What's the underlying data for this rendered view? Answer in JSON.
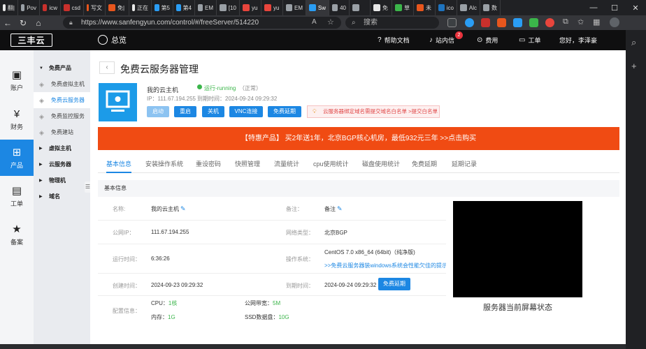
{
  "browser": {
    "tabs": [
      {
        "label": "翻|",
        "color": "#e8e8e8"
      },
      {
        "label": "Pov",
        "color": "#9aa0a6"
      },
      {
        "label": "icw",
        "color": "#c9302c"
      },
      {
        "label": "csd",
        "color": "#c9302c"
      },
      {
        "label": "写文",
        "color": "#e8561d"
      },
      {
        "label": "免|",
        "color": "#e8561d"
      },
      {
        "label": "正在",
        "color": "#e8e8e8"
      },
      {
        "label": "第5",
        "color": "#2a9df4"
      },
      {
        "label": "第4",
        "color": "#2a9df4"
      },
      {
        "label": "EM",
        "color": "#9aa0a6"
      },
      {
        "label": "[10",
        "color": "#9aa0a6"
      },
      {
        "label": "yu",
        "color": "#e8453c"
      },
      {
        "label": "yu",
        "color": "#e8453c"
      },
      {
        "label": "EM",
        "color": "#9aa0a6"
      },
      {
        "label": "Sw",
        "color": "#2a9df4"
      },
      {
        "label": "40",
        "color": "#9aa0a6"
      },
      {
        "label": "",
        "color": "#9aa0a6"
      },
      {
        "label": "免",
        "color": "#e8e8e8"
      },
      {
        "label": "草",
        "color": "#3bb54a"
      },
      {
        "label": "未",
        "color": "#e8561d"
      },
      {
        "label": "ico",
        "color": "#1e73be"
      },
      {
        "label": "Alc",
        "color": "#9aa0a6"
      },
      {
        "label": "数",
        "color": "#9aa0a6"
      }
    ],
    "url": "https://www.sanfengyun.com/control/#/freeServer/514220",
    "search_placeholder": "搜索"
  },
  "topnav": {
    "logo": "三丰云",
    "overview": "总览",
    "help": "帮助文档",
    "messages": "站内信",
    "message_count": "2",
    "fees": "费用",
    "tickets": "工单",
    "greeting": "您好，李泽豪"
  },
  "leftnav": [
    {
      "label": "账户",
      "icon": "account-icon",
      "glyph": "▣"
    },
    {
      "label": "财务",
      "icon": "finance-icon",
      "glyph": "¥"
    },
    {
      "label": "产品",
      "icon": "product-icon",
      "glyph": "⊞",
      "active": true
    },
    {
      "label": "工单",
      "icon": "ticket-icon",
      "glyph": "▤"
    },
    {
      "label": "备案",
      "icon": "record-icon",
      "glyph": "★"
    }
  ],
  "subnav": {
    "free_products": "免费产品",
    "free_vm": "免费虚拟主机",
    "free_cloud": "免费云服务器",
    "free_monitor": "免费监控服务",
    "free_site": "免费建站",
    "vm": "虚拟主机",
    "cloud": "云服务器",
    "physical": "物理机",
    "domain": "域名"
  },
  "server": {
    "page_title": "免费云服务器管理",
    "name": "我的云主机",
    "status": "运行-running",
    "status_cn": "（正常）",
    "ip_line": "IP：111.67.194.255",
    "expire_line": "到期时间：2024-09-24 09:29:32",
    "buttons": {
      "start": "启动",
      "restart": "重启",
      "shutdown": "关机",
      "vnc": "VNC连接",
      "renew": "免费延期"
    },
    "notice": "云服务器绑定域名需提交域名白名单 >提交白名单"
  },
  "promo": "【特惠产品】 买2年送1年，北京BGP核心机房，最低932元三年 >>点击购买",
  "tabs": [
    "基本信息",
    "安装操作系统",
    "重设密码",
    "快照管理",
    "流量统计",
    "cpu使用统计",
    "磁盘使用统计",
    "免费延期",
    "延期记录"
  ],
  "info": {
    "section_title": "基本信息",
    "name_label": "名称:",
    "name_value": "我的云主机",
    "remark_label": "备注：",
    "remark_value": "备注",
    "ip_label": "公网IP：",
    "ip_value": "111.67.194.255",
    "network_label": "网络类型：",
    "network_value": "北京BGP",
    "uptime_label": "运行时间：",
    "uptime_value": "6:36:26",
    "os_label": "操作系统：",
    "os_value": "CentOS 7.0 x86_64 (64bit)（纯净版)",
    "os_link": ">>免费云服务器装windows系统会性能欠佳的提示",
    "created_label": "创建时间：",
    "created_value": "2024-09-23 09:29:32",
    "expire_label": "到期时间：",
    "expire_value": "2024-09-24 09:29:32",
    "renew_button": "免费延期",
    "config_label": "配置信息：",
    "cpu_label": "CPU：",
    "cpu_value": "1核",
    "bandwidth_label": "公网带宽：",
    "bandwidth_value": "5M",
    "mem_label": "内存：",
    "mem_value": "1G",
    "disk_label": "SSD数据盘：",
    "disk_value": "10G",
    "screen_caption": "服务器当前屏幕状态"
  },
  "colors": {
    "accent": "#1c87e3",
    "promo": "#f04b13",
    "running": "#3bb54a"
  }
}
